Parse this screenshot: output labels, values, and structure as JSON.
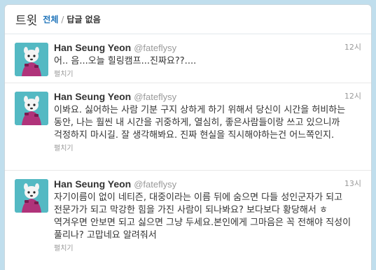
{
  "header": {
    "title": "트윗",
    "crumb_all": "전체",
    "separator": "/",
    "crumb_current": "답글 없음"
  },
  "tweets": [
    {
      "name": "Han Seung Yeon",
      "handle": "@fateflysy",
      "time": "12시",
      "text": "어.. 음...오늘 힐링캠프...진짜요??....",
      "expand_label": "펼치기"
    },
    {
      "name": "Han Seung Yeon",
      "handle": "@fateflysy",
      "time": "12시",
      "text": "이봐요. 싫어하는 사람 기분 구지 상하게 하기 위해서 당신이 시간을 허비하는 동안, 나는 훨씬 내 시간을 귀중하게, 열심히, 좋은사람들이랑 쓰고 있으니까 걱정하지 마시길. 잘 생각해봐요. 진짜 현실을 직시해야하는건 어느쪽인지.",
      "expand_label": "펼치기"
    },
    {
      "name": "Han Seung Yeon",
      "handle": "@fateflysy",
      "time": "13시",
      "text": "자기이름이 없이 네티즌, 대중이라는 이름 뒤에 숨으면 다들 성인군자가 되고 전문가가 되고 막강한 힘을 가진 사람이 되나봐요? 보다보다 황당해서 ㅎ 역겨우면 안보면 되고 싫으면 그냥 두세요.본인에게 그마음은 꼭 전해야 직성이 풀리나? 고맙네요 알려줘서",
      "expand_label": "펼치기"
    }
  ],
  "colors": {
    "background": "#c0deed",
    "link": "#2276bb",
    "avatar_bg": "#54b9c3"
  }
}
